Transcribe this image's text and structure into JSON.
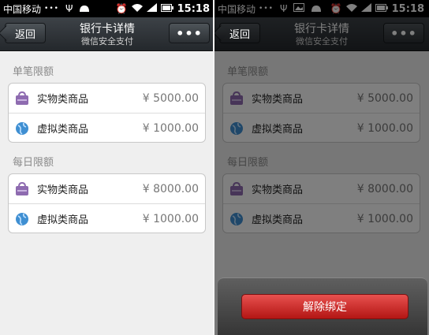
{
  "statusbar": {
    "carrier": "中国移动",
    "time": "15:18"
  },
  "nav": {
    "back_label": "返回",
    "title": "银行卡详情",
    "subtitle": "微信安全支付",
    "more_label": "•••"
  },
  "sections": [
    {
      "title": "单笔限额",
      "rows": [
        {
          "label": "实物类商品",
          "value": "¥ 5000.00",
          "icon": "bag-icon"
        },
        {
          "label": "虚拟类商品",
          "value": "¥ 1000.00",
          "icon": "globe-icon"
        }
      ]
    },
    {
      "title": "每日限额",
      "rows": [
        {
          "label": "实物类商品",
          "value": "¥ 8000.00",
          "icon": "bag-icon"
        },
        {
          "label": "虚拟类商品",
          "value": "¥ 1000.00",
          "icon": "globe-icon"
        }
      ]
    }
  ],
  "action_sheet": {
    "unbind_label": "解除绑定"
  },
  "colors": {
    "bag": "#8e6bb0",
    "globe": "#3f8fd2",
    "danger": "#d9302d"
  }
}
